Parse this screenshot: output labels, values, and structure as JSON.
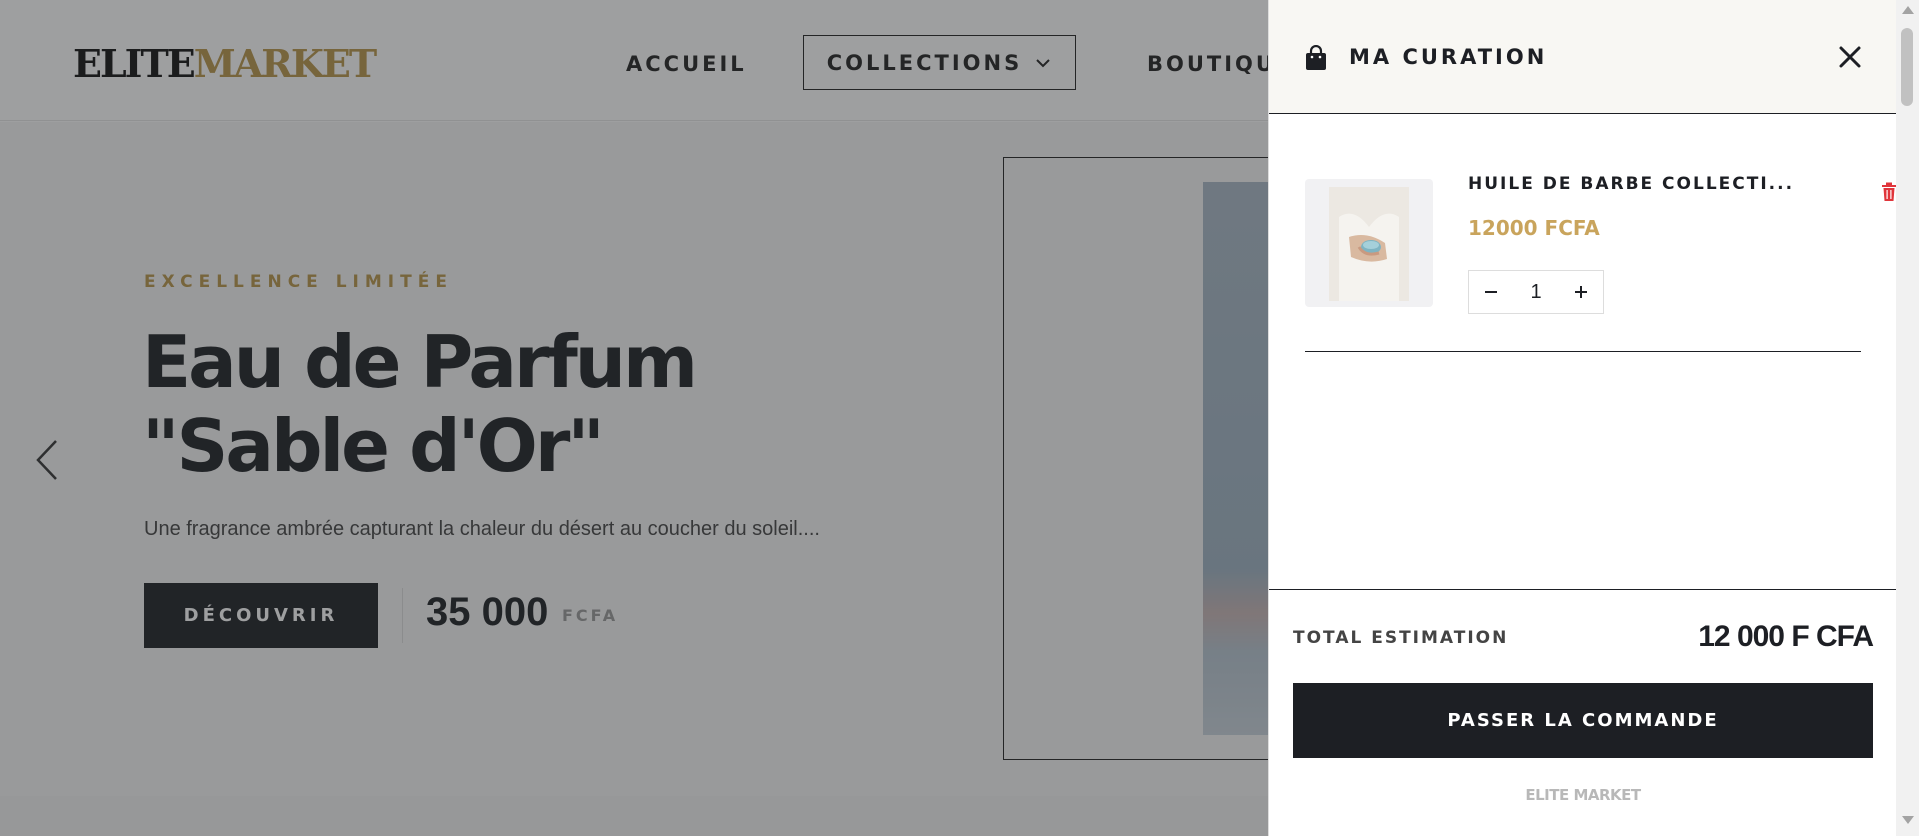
{
  "site": {
    "logo": {
      "part1": "ELITE",
      "part2": "MARKET"
    },
    "nav": {
      "home": "ACCUEIL",
      "collections": "COLLECTIONS",
      "shop": "BOUTIQUE"
    },
    "hero": {
      "eyebrow": "EXCELLENCE LIMITÉE",
      "title": "Eau de Parfum \"Sable d'Or\"",
      "description": "Une fragrance ambrée capturant la chaleur du désert au coucher du soleil....",
      "cta": "DÉCOUVRIR",
      "price": "35 000",
      "currency": "FCFA"
    }
  },
  "drawer": {
    "title": "MA CURATION",
    "items": [
      {
        "name": "HUILE DE BARBE COLLECTI...",
        "price": "12000 FCFA",
        "quantity": "1"
      }
    ],
    "total_label": "TOTAL ESTIMATION",
    "total_value": "12 000 F CFA",
    "checkout": "PASSER LA COMMANDE",
    "brand": "ELITE MARKET"
  },
  "colors": {
    "accent_gold": "#b8954a",
    "dark": "#1d1f24",
    "delete_red": "#e0353b"
  },
  "icons": [
    "shopping-bag-icon",
    "close-icon",
    "trash-icon",
    "minus-icon",
    "plus-icon",
    "chevron-down-icon",
    "chevron-left-icon"
  ]
}
